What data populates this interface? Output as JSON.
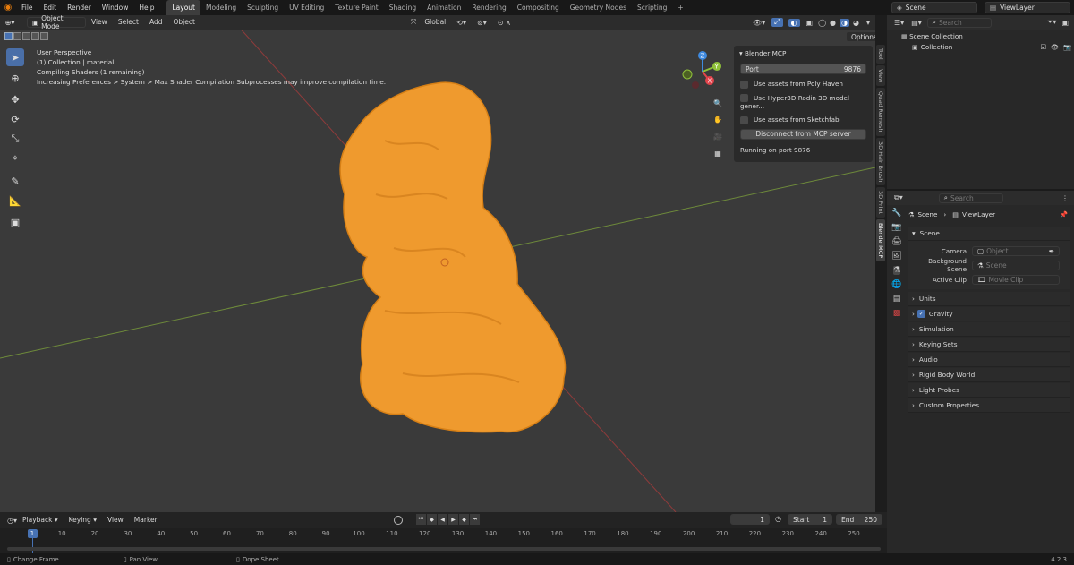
{
  "menus": [
    "File",
    "Edit",
    "Render",
    "Window",
    "Help"
  ],
  "workspaces": [
    "Layout",
    "Modeling",
    "Sculpting",
    "UV Editing",
    "Texture Paint",
    "Shading",
    "Animation",
    "Rendering",
    "Compositing",
    "Geometry Nodes",
    "Scripting"
  ],
  "active_workspace": "Layout",
  "scene_name": "Scene",
  "viewlayer_name": "ViewLayer",
  "viewport": {
    "mode": "Object Mode",
    "menus": [
      "View",
      "Select",
      "Add",
      "Object"
    ],
    "orientation": "Global",
    "options": "Options",
    "overlay_lines": [
      "User Perspective",
      "(1) Collection | material",
      "Compiling Shaders (1 remaining)",
      "Increasing Preferences > System > Max Shader Compilation Subprocesses may improve compilation time."
    ],
    "gizmo_axes": [
      "Z",
      "Y",
      "X"
    ]
  },
  "mcp_panel": {
    "title": "Blender MCP",
    "port_label": "Port",
    "port_value": "9876",
    "options": [
      "Use assets from Poly Haven",
      "Use Hyper3D Rodin 3D model gener...",
      "Use assets from Sketchfab"
    ],
    "button": "Disconnect from MCP server",
    "status": "Running on port 9876"
  },
  "side_tabs": [
    "Tool",
    "View",
    "Quad Remesh",
    "3D Hair Brush",
    "3D Print",
    "BlenderMCP"
  ],
  "outliner": {
    "search_placeholder": "Search",
    "items": [
      "Scene Collection",
      "Collection"
    ]
  },
  "properties": {
    "search_placeholder": "Search",
    "breadcrumb": [
      "Scene",
      "ViewLayer"
    ],
    "section": "Scene",
    "fields": [
      {
        "label": "Camera",
        "placeholder": "Object"
      },
      {
        "label": "Background Scene",
        "placeholder": "Scene"
      },
      {
        "label": "Active Clip",
        "placeholder": "Movie Clip"
      }
    ],
    "panels": [
      "Units",
      "Gravity",
      "Simulation",
      "Keying Sets",
      "Audio",
      "Rigid Body World",
      "Light Probes",
      "Custom Properties"
    ]
  },
  "timeline": {
    "menus": [
      "Playback",
      "Keying",
      "View",
      "Marker"
    ],
    "current_frame": "1",
    "start_label": "Start",
    "start": "1",
    "end_label": "End",
    "end": "250",
    "ticks": [
      "1",
      "10",
      "20",
      "30",
      "40",
      "50",
      "60",
      "70",
      "80",
      "90",
      "100",
      "110",
      "120",
      "130",
      "140",
      "150",
      "160",
      "170",
      "180",
      "190",
      "200",
      "210",
      "220",
      "230",
      "240",
      "250"
    ]
  },
  "status": {
    "items": [
      "Change Frame",
      "Pan View",
      "Dope Sheet"
    ],
    "version": "4.2.3"
  },
  "colors": {
    "accent": "#4772b3",
    "object": "#f0962d",
    "x_axis": "#e2434b",
    "y_axis": "#8fc13a",
    "z_axis": "#3e8ae0"
  }
}
